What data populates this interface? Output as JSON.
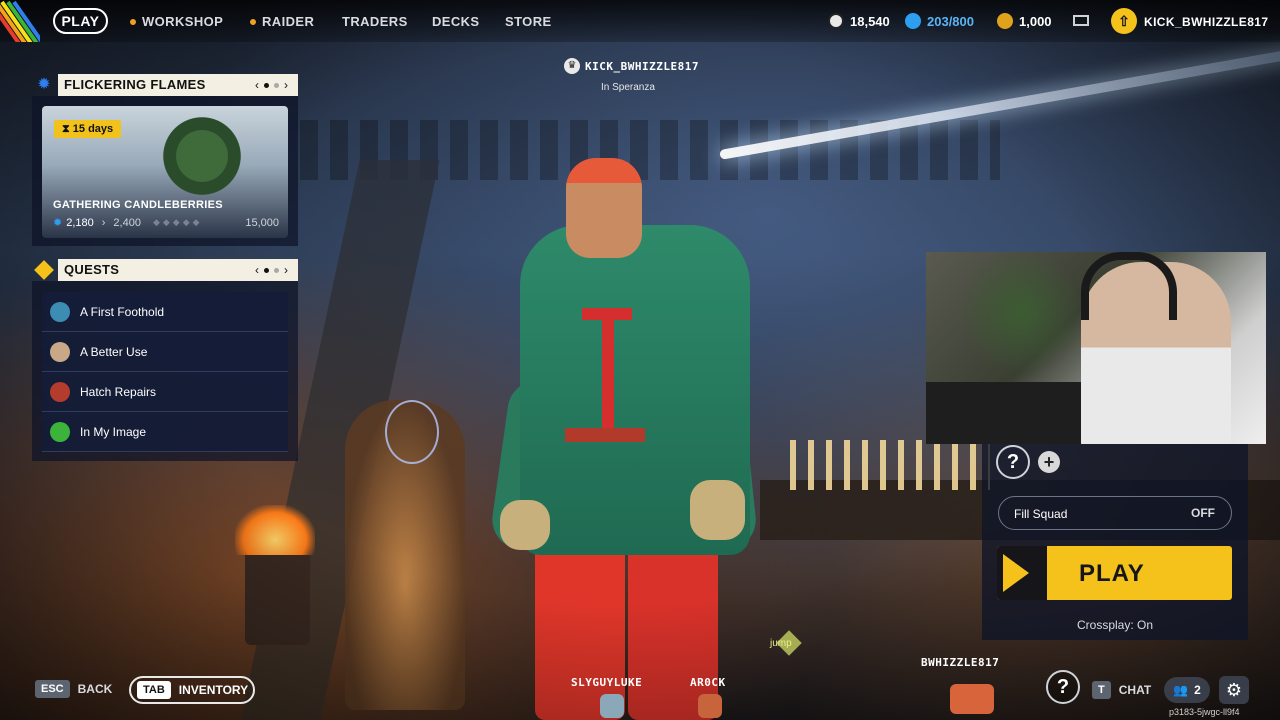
{
  "nav": {
    "play": "PLAY",
    "workshop": "WORKSHOP",
    "raider": "RAIDER",
    "traders": "TRADERS",
    "decks": "DECKS",
    "store": "STORE"
  },
  "currencies": {
    "credits": "18,540",
    "tokens": "203/800",
    "coins": "1,000"
  },
  "user": {
    "badge_icon": "arrow-up-icon",
    "name": "KICK_BWHIZZLE817"
  },
  "center_tag": {
    "name": "KICK_BWHIZZLE817",
    "location": "In Speranza"
  },
  "event_panel": {
    "title": "FLICKERING FLAMES",
    "days_badge": "15  days",
    "card_title": "GATHERING CANDLEBERRIES",
    "progress_current": "2,180",
    "progress_next": "2,400",
    "progress_max": "15,000"
  },
  "quests_panel": {
    "title": "QUESTS",
    "items": [
      {
        "label": "A First Foothold",
        "color": "#3c8cb4"
      },
      {
        "label": "A Better Use",
        "color": "#c8a888"
      },
      {
        "label": "Hatch Repairs",
        "color": "#b43c2c"
      },
      {
        "label": "In My Image",
        "color": "#3cb43c"
      }
    ]
  },
  "squad": {
    "fill_label": "Fill Squad",
    "fill_value": "OFF",
    "play_label": "PLAY",
    "crossplay": "Crossplay: On"
  },
  "squad_members": {
    "m1": "SLYGUYLUKE",
    "m2": "AR0CK",
    "m3": "BWHIZZLE817",
    "jump": "jump"
  },
  "bottom": {
    "esc_key": "ESC",
    "back": "BACK",
    "tab_key": "TAB",
    "inventory": "INVENTORY",
    "chat_key": "T",
    "chat": "CHAT",
    "friends_count": "2",
    "build_id": "p3183-5jwgc-ll9f4"
  },
  "colors": {
    "accent_yellow": "#f4c21a",
    "accent_blue": "#2e7ff0",
    "panel_bg": "#0e1428"
  }
}
